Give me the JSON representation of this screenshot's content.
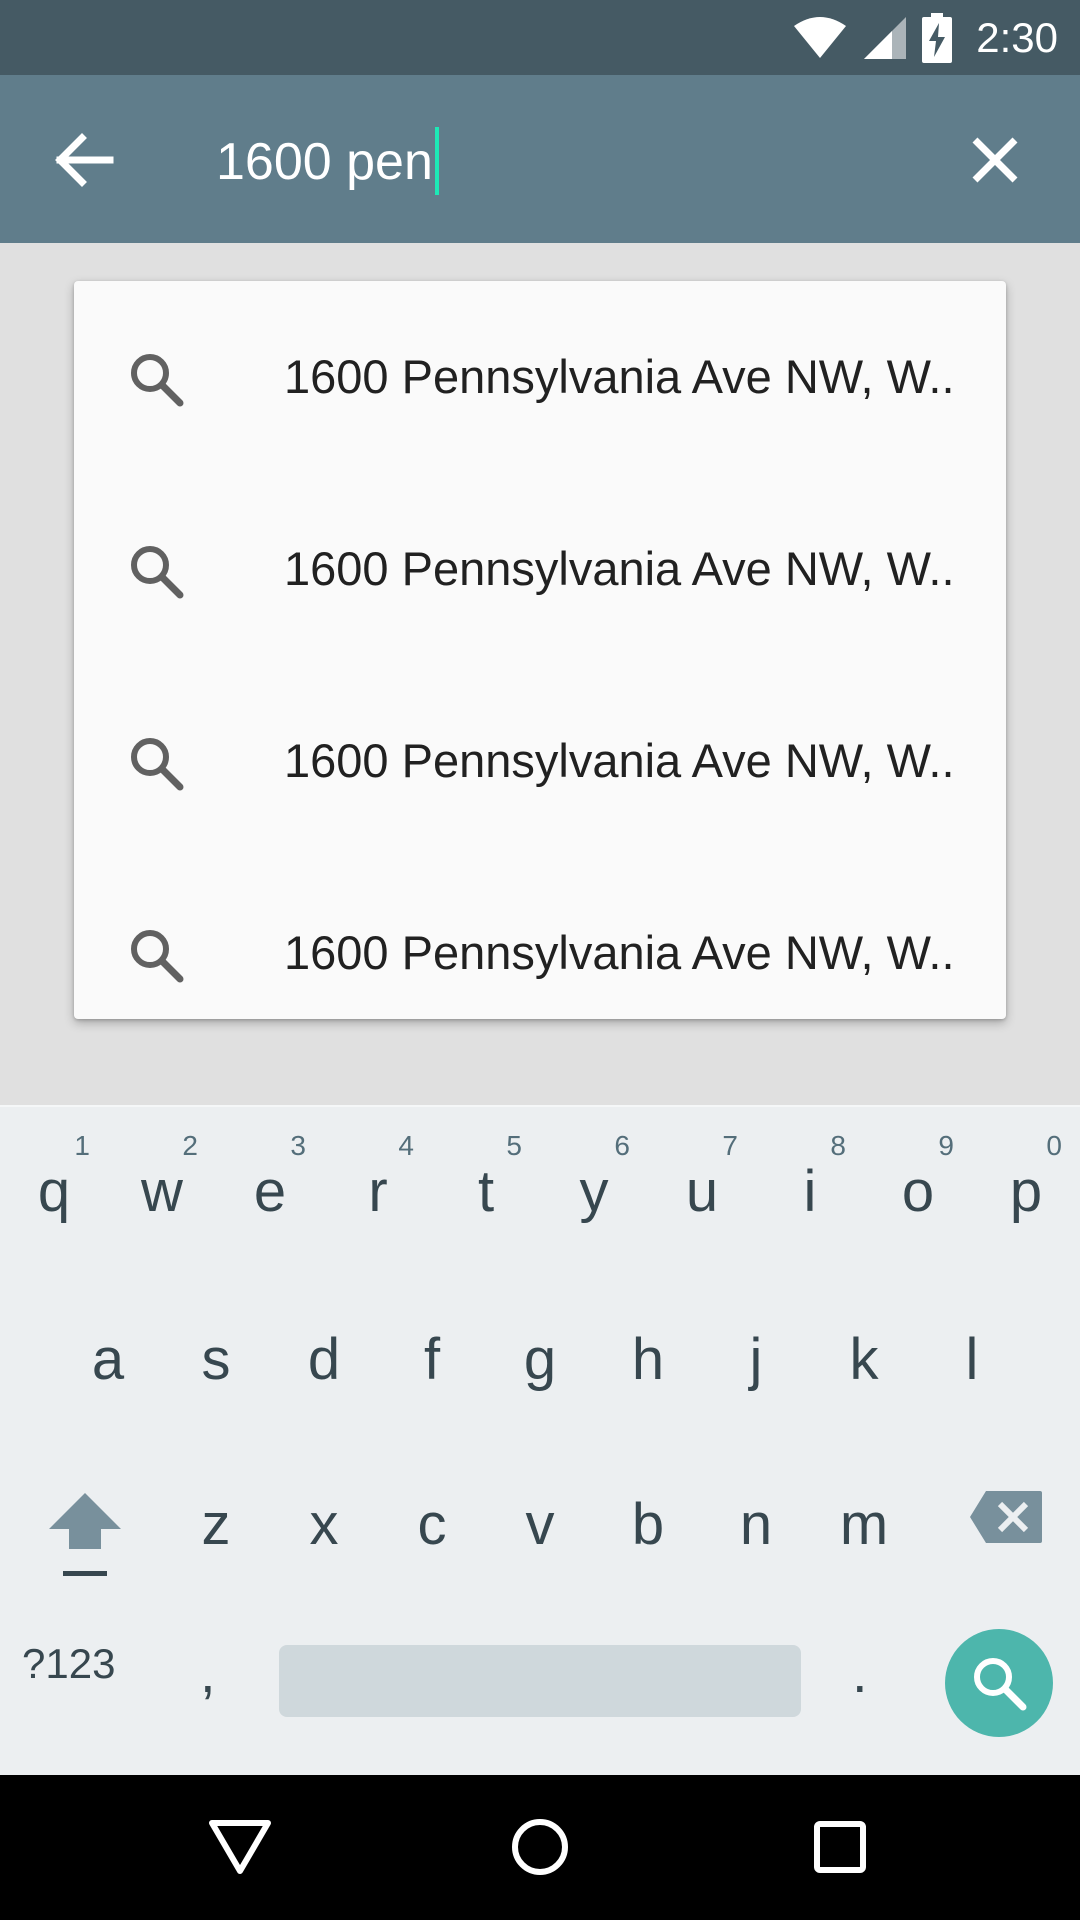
{
  "status_bar": {
    "time": "2:30",
    "icons": [
      "wifi-icon",
      "cell-signal-icon",
      "battery-charging-icon"
    ]
  },
  "toolbar": {
    "query": "1600 pen",
    "icons": [
      "arrow-back-icon",
      "close-icon"
    ]
  },
  "suggestions": [
    {
      "text": "1600 Pennsylvania Ave NW, W..",
      "icon": "search-icon"
    },
    {
      "text": "1600 Pennsylvania Ave NW, W..",
      "icon": "search-icon"
    },
    {
      "text": "1600 Pennsylvania Ave NW, W..",
      "icon": "search-icon"
    },
    {
      "text": "1600 Pennsylvania Ave NW, W..",
      "icon": "search-icon"
    }
  ],
  "keyboard": {
    "row1": [
      {
        "letter": "q",
        "hint": "1"
      },
      {
        "letter": "w",
        "hint": "2"
      },
      {
        "letter": "e",
        "hint": "3"
      },
      {
        "letter": "r",
        "hint": "4"
      },
      {
        "letter": "t",
        "hint": "5"
      },
      {
        "letter": "y",
        "hint": "6"
      },
      {
        "letter": "u",
        "hint": "7"
      },
      {
        "letter": "i",
        "hint": "8"
      },
      {
        "letter": "o",
        "hint": "9"
      },
      {
        "letter": "p",
        "hint": "0"
      }
    ],
    "row2": [
      "a",
      "s",
      "d",
      "f",
      "g",
      "h",
      "j",
      "k",
      "l"
    ],
    "row3": [
      "z",
      "x",
      "c",
      "v",
      "b",
      "n",
      "m"
    ],
    "symbols_label": "?123",
    "comma": ",",
    "period": ".",
    "icons": [
      "shift-icon",
      "backspace-icon",
      "search-icon"
    ]
  },
  "nav_bar": {
    "icons": [
      "back-triangle-icon",
      "home-circle-icon",
      "recents-square-icon"
    ]
  },
  "colors": {
    "status_bar": "#455a64",
    "toolbar": "#607d8b",
    "caret": "#1de9b6",
    "search_key": "#4db6ac",
    "keyboard_bg": "#eceff1"
  }
}
